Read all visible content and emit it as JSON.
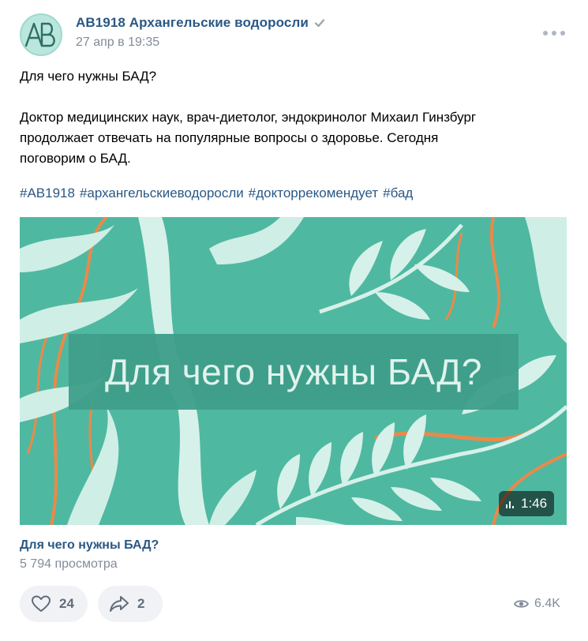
{
  "post": {
    "author": "AB1918 Архангельские водоросли",
    "avatar_text": "AB",
    "date": "27 апр в 19:35",
    "text_title": "Для чего нужны БАД?",
    "text_body_1": "Доктор медицинских наук, врач-диетолог, эндокринолог Михаил Гинзбург",
    "text_body_2": "продолжает отвечать на популярные вопросы о здоровье. Сегодня",
    "text_body_3": "поговорим о БАД.",
    "hashtags": [
      "#AB1918",
      "#архангельскиеводоросли",
      "#докторрекомендует",
      "#бад"
    ]
  },
  "video": {
    "overlay_title": "Для чего нужны БАД?",
    "duration": "1:46",
    "title": "Для чего нужны БАД?",
    "views": "5 794 просмотра"
  },
  "actions": {
    "likes": "24",
    "shares": "2",
    "views": "6.4K"
  },
  "icons": {
    "verified": "verified-check-icon",
    "more": "more-dots-icon",
    "like": "heart-icon",
    "share": "share-arrow-icon",
    "views": "eye-icon",
    "duration": "bar-chart-icon"
  },
  "colors": {
    "link": "#2a5885",
    "muted": "#818c99",
    "video_bg": "#4fb8a1",
    "band": "#3f9f8b",
    "accent_orange": "#e98a4a"
  }
}
